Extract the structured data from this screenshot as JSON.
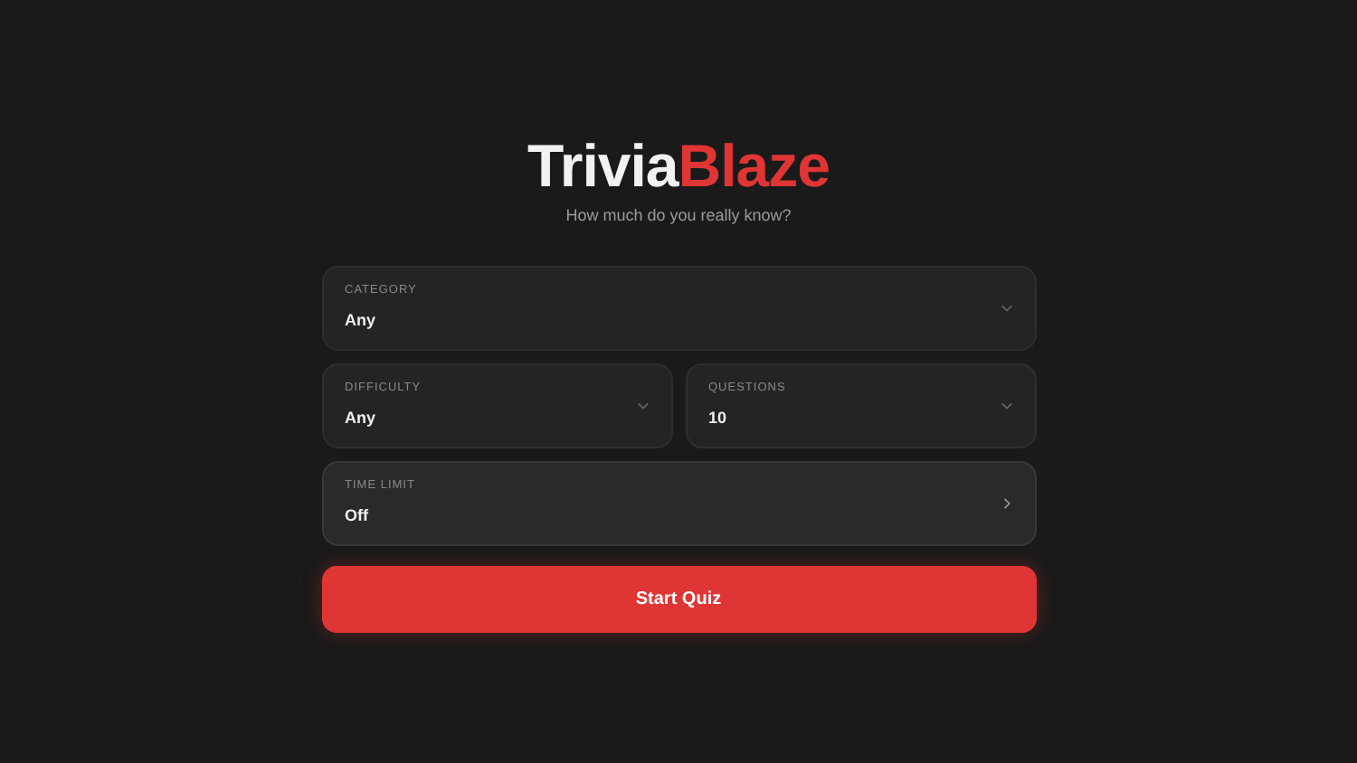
{
  "logo": {
    "first": "Trivia",
    "second": "Blaze"
  },
  "tagline": "How much do you really know?",
  "field_rows": [
    [
      {
        "label": "CATEGORY",
        "value": "Any",
        "highlighted": false
      }
    ],
    [
      {
        "label": "DIFFICULTY",
        "value": "Any",
        "highlighted": false
      },
      {
        "label": "QUESTIONS",
        "value": "10",
        "highlighted": false
      }
    ],
    [
      {
        "label": "TIME LIMIT",
        "value": "Off",
        "highlighted": true
      }
    ]
  ],
  "start_button": "Start Quiz"
}
